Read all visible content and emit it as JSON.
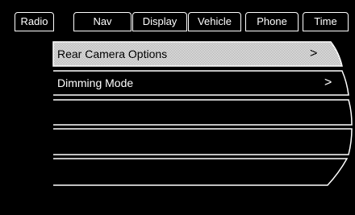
{
  "tabs": [
    {
      "label": "Radio"
    },
    {
      "label": "Nav"
    },
    {
      "label": "Display"
    },
    {
      "label": "Vehicle"
    },
    {
      "label": "Phone"
    },
    {
      "label": "Time"
    }
  ],
  "menu": {
    "selected_index": 0,
    "items": [
      {
        "label": "Rear Camera Options",
        "chevron": ">"
      },
      {
        "label": "Dimming Mode",
        "chevron": ">"
      },
      {
        "label": ""
      },
      {
        "label": ""
      },
      {
        "label": ""
      }
    ]
  }
}
